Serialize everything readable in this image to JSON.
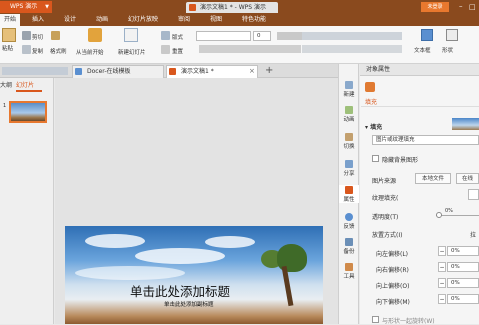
{
  "titlebar": {
    "app_menu": "WPS 演示",
    "tab_active": "演示文稿1 *",
    "window_title": "演示文稿1 * - WPS 演示",
    "login": "未登录"
  },
  "menus": [
    "开始",
    "插入",
    "设计",
    "动画",
    "幻灯片放映",
    "审阅",
    "视图",
    "特色功能"
  ],
  "ribbon": {
    "paste": "粘贴",
    "cut": "剪切",
    "copy": "复制",
    "format_painter": "格式刷",
    "from_current": "从当前开始",
    "new_slide": "新建幻灯片",
    "layout": "版式",
    "reset": "重置",
    "font_size": "0",
    "textbox": "文本框",
    "shape": "形状"
  },
  "doc_tabs": [
    {
      "label": "Docer-在线模板"
    },
    {
      "label": "演示文稿1 *"
    }
  ],
  "left_panel": {
    "tab_outline": "大纲",
    "tab_slides": "幻灯片",
    "slide_number": "1"
  },
  "slide": {
    "title": "单击此处添加标题",
    "subtitle": "单击此处添加副标题"
  },
  "vstrip": [
    "新建",
    "动画",
    "切换",
    "分享",
    "属性",
    "反馈",
    "备份",
    "工具"
  ],
  "props": {
    "header": "对象属性",
    "fill_tab": "填充",
    "fill_section": "填充",
    "fill_type": "图片或纹理填充",
    "hide_bg": "隐藏背景图形",
    "pic_source": "图片来源",
    "local_file": "本地文件",
    "online": "在线",
    "tile": "纹理填充(",
    "transparency": "透明度(T)",
    "transparency_value": "0%",
    "offset_mode": "放置方式(I)",
    "stretch": "拉",
    "left_offset": "向左偏移(L)",
    "right_offset": "向右偏移(R)",
    "up_offset": "向上偏移(O)",
    "down_offset": "向下偏移(M)",
    "offset_value": "0%",
    "rotate_with_shape": "与形状一起旋转(W)"
  },
  "colors": {
    "brand_orange": "#d9571d",
    "title_brown": "#8a4a1e",
    "login_orange": "#e8782e"
  }
}
